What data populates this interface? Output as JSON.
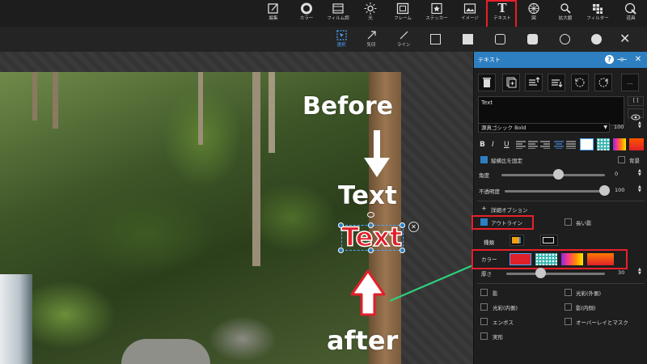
{
  "toolbar": {
    "items": [
      {
        "label": "編集",
        "icon": "edit-icon"
      },
      {
        "label": "カラー",
        "icon": "color-ring-icon"
      },
      {
        "label": "フィルム調",
        "icon": "film-icon"
      },
      {
        "label": "光",
        "icon": "sun-icon"
      },
      {
        "label": "フレーム",
        "icon": "frame-icon"
      },
      {
        "label": "ステッカー",
        "icon": "sticker-icon"
      },
      {
        "label": "イメージ",
        "icon": "image-icon"
      },
      {
        "label": "テキスト",
        "icon": "text-T-icon",
        "glyph": "T"
      },
      {
        "label": "図",
        "icon": "shape-icon"
      },
      {
        "label": "拡大鏡",
        "icon": "magnifier-icon"
      },
      {
        "label": "フィルター",
        "icon": "filter-icon"
      },
      {
        "label": "道具",
        "icon": "tools-icon"
      }
    ],
    "highlight_color": "#e8202a"
  },
  "subbar": {
    "select_label": "選択",
    "arrow_label": "矢印",
    "line_label": "ライン",
    "close_glyph": "✕"
  },
  "canvas": {
    "before_text": "Before",
    "text_plain": "Text",
    "text_outlined": "Text",
    "after_text": "after",
    "delete_glyph": "✕",
    "accent_arrow_color": "#2fd07d"
  },
  "panel": {
    "title": "テキスト",
    "help_glyph": "?",
    "pin_glyph": "⊣⊢",
    "close_glyph": "✕",
    "more_glyph": "...",
    "text_value": "Text",
    "bracket_glyph": "[ ]",
    "font_name": "源真ゴシック Bold",
    "font_size": "100",
    "bold": "B",
    "italic": "I",
    "underline": "U",
    "keep_ratio_label": "縦横比を固定",
    "background_label": "背景",
    "angle_label": "角度",
    "angle_value": "0",
    "opacity_label": "不透明度",
    "opacity_value": "100",
    "details_label": "詳細オプション",
    "details_glyph": "+",
    "outline_label": "アウトライン",
    "long_shadow_label": "長い影",
    "type_label": "種類",
    "color_label": "カラー",
    "thickness_label": "厚さ",
    "thickness_value": "30",
    "effects_left": [
      "影",
      "光彩(内側)",
      "エンボス",
      "実形"
    ],
    "effects_right": [
      "光彩(外側)",
      "影(内側)",
      "オーバーレイとマスク"
    ],
    "selected_color": "#e0202a",
    "accent": "#2d7fc1"
  }
}
